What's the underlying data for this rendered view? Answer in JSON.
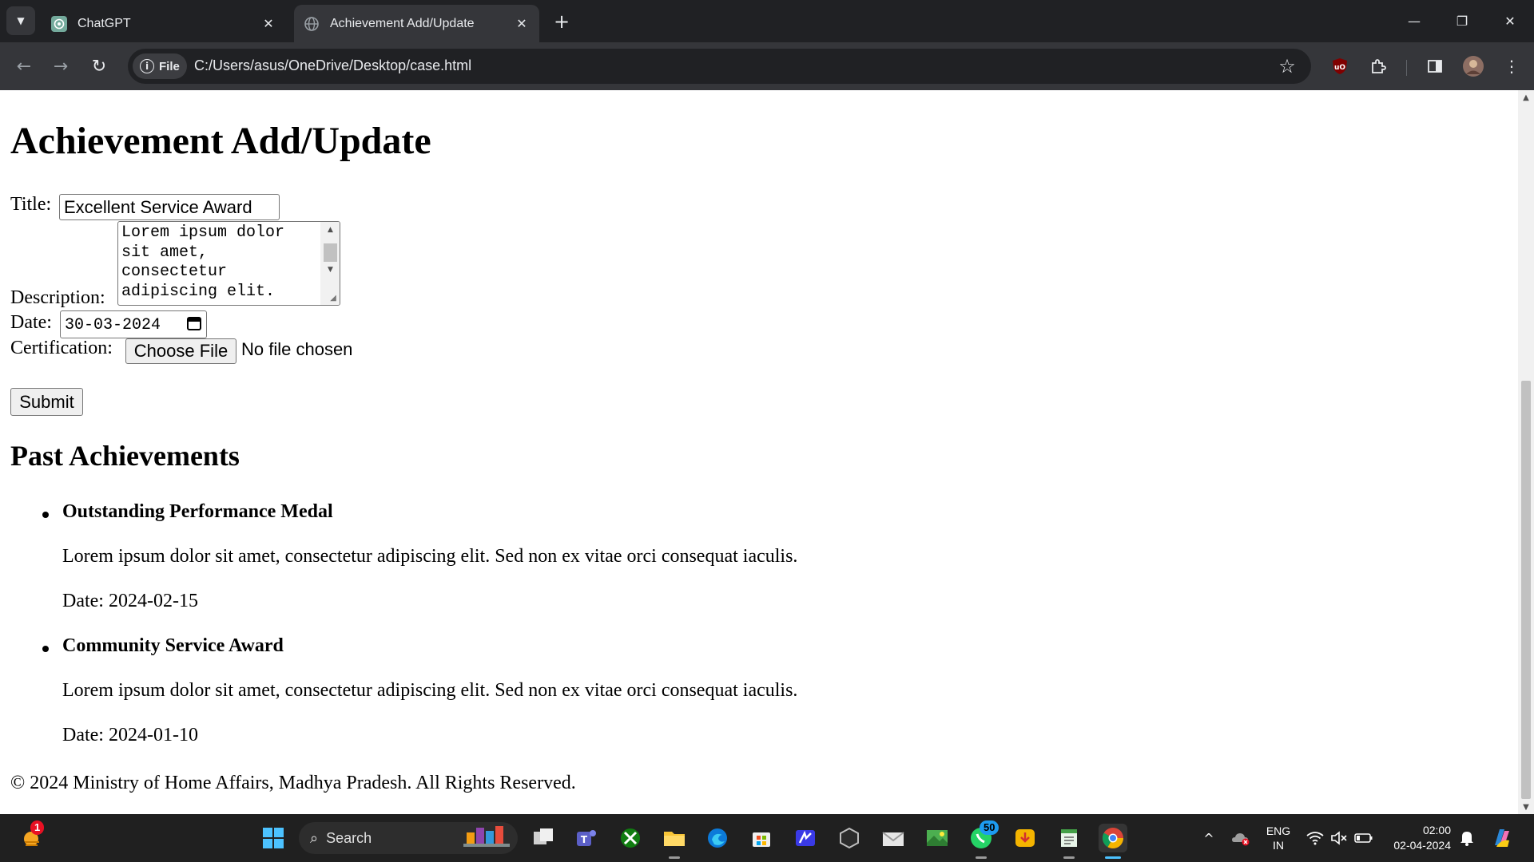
{
  "browser": {
    "tabs": [
      {
        "title": "ChatGPT",
        "active": false
      },
      {
        "title": "Achievement Add/Update",
        "active": true
      }
    ],
    "omnibox": {
      "chip_label": "File",
      "url": "C:/Users/asus/OneDrive/Desktop/case.html"
    },
    "colors": {
      "tabstrip": "#202124",
      "toolbar": "#35363a",
      "omnibox": "#202124"
    }
  },
  "page": {
    "heading": "Achievement Add/Update",
    "form": {
      "title_label": "Title:",
      "title_value": "Excellent Service Award",
      "description_label": "Description:",
      "description_value": "Lorem ipsum dolor sit amet, consectetur adipiscing elit.",
      "date_label": "Date:",
      "date_value": "30-03-2024",
      "certification_label": "Certification:",
      "choose_file_label": "Choose File",
      "no_file_text": "No file chosen",
      "submit_label": "Submit"
    },
    "past_heading": "Past Achievements",
    "achievements": [
      {
        "title": "Outstanding Performance Medal",
        "description": "Lorem ipsum dolor sit amet, consectetur adipiscing elit. Sed non ex vitae orci consequat iaculis.",
        "date": "Date: 2024-02-15"
      },
      {
        "title": "Community Service Award",
        "description": "Lorem ipsum dolor sit amet, consectetur adipiscing elit. Sed non ex vitae orci consequat iaculis.",
        "date": "Date: 2024-01-10"
      }
    ],
    "footer": "© 2024 Ministry of Home Affairs, Madhya Pradesh. All Rights Reserved."
  },
  "taskbar": {
    "search_placeholder": "Search",
    "weather_badge": "1",
    "whatsapp_badge": "50",
    "language_line1": "ENG",
    "language_line2": "IN",
    "time": "02:00",
    "date": "02-04-2024",
    "apps": [
      "widgets-weather",
      "start",
      "search",
      "task-view",
      "teams",
      "xbox",
      "file-explorer",
      "edge",
      "microsoft-store",
      "code-editor",
      "unity",
      "mail",
      "photos",
      "whatsapp",
      "downloader",
      "notepad",
      "chrome"
    ]
  }
}
